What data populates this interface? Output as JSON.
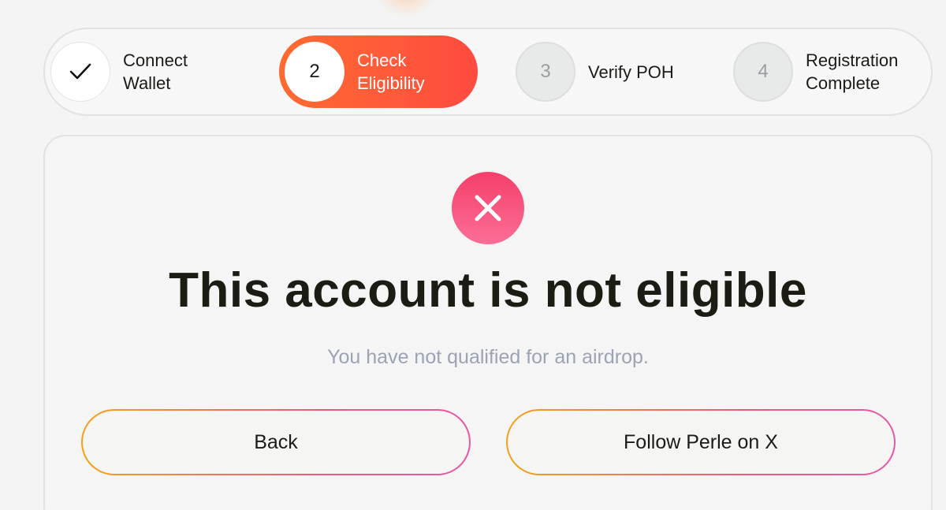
{
  "stepper": {
    "steps": [
      {
        "number": "",
        "icon": "check-icon",
        "label_line1": "Connect",
        "label_line2": "Wallet",
        "status": "complete"
      },
      {
        "number": "2",
        "label_line1": "Check",
        "label_line2": "Eligibility",
        "status": "active"
      },
      {
        "number": "3",
        "label_line1": "Verify POH",
        "label_line2": "",
        "status": "pending"
      },
      {
        "number": "4",
        "label_line1": "Registration",
        "label_line2": "Complete",
        "status": "pending"
      }
    ]
  },
  "result": {
    "icon": "error-x-icon",
    "title": "This account is not eligible",
    "subtitle": "You have not qualified for an airdrop."
  },
  "actions": {
    "back_label": "Back",
    "follow_label": "Follow Perle on X"
  },
  "colors": {
    "active_step": "#ff5a3a",
    "error_icon": "#f53f6a",
    "button_border_start": "#f3a21c",
    "button_border_end": "#e45aa8"
  }
}
